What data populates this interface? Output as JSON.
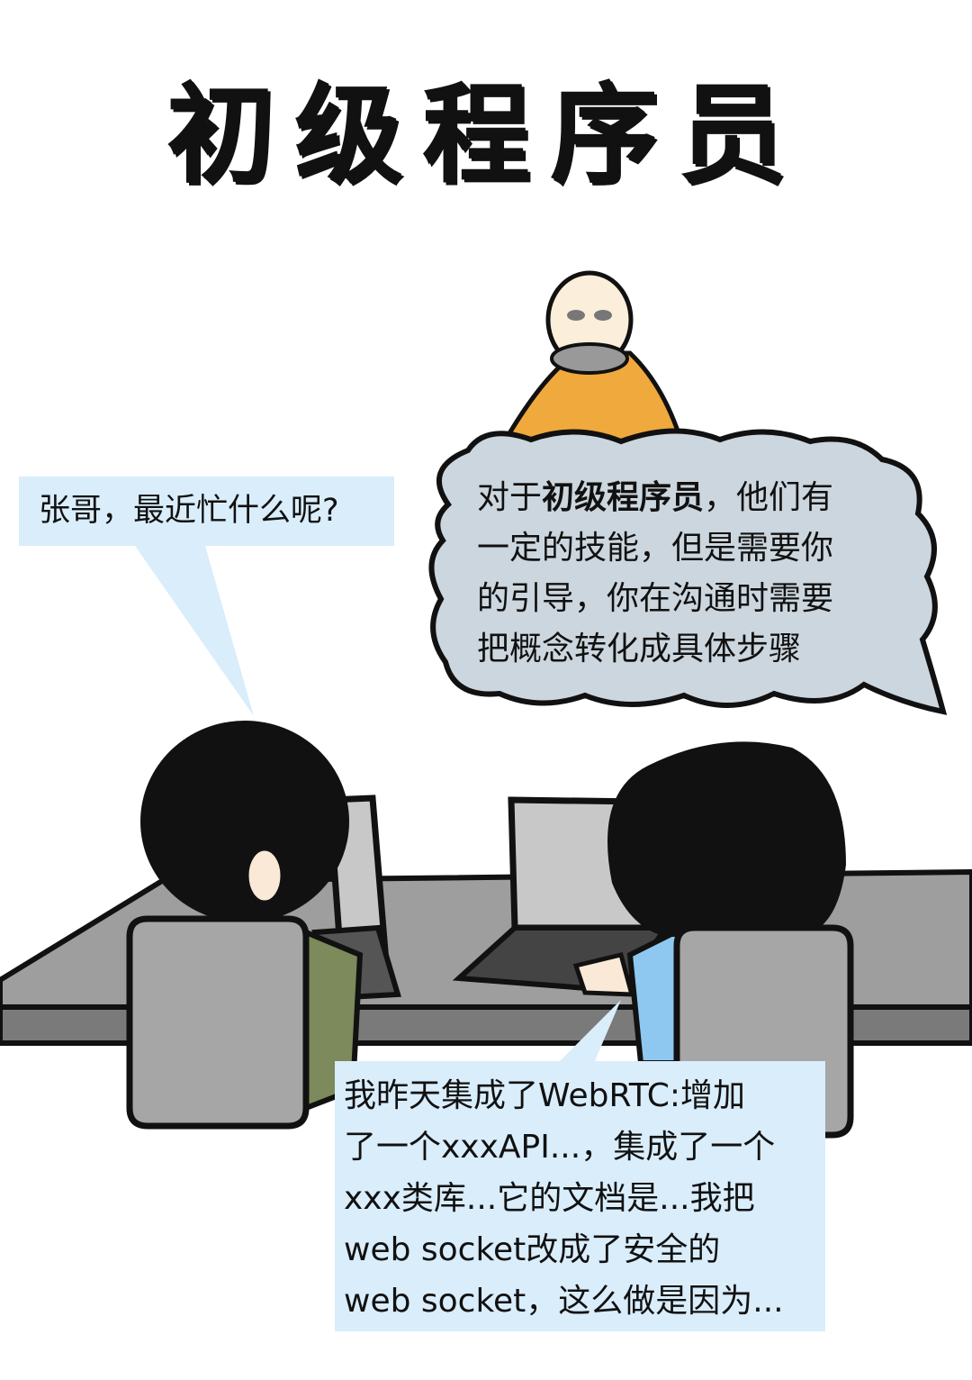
{
  "title": "初级程序员",
  "bubbles": {
    "question": "张哥，最近忙什么呢?",
    "narrator": {
      "prefix": "对于",
      "highlight": "初级程序员",
      "suffix": "，他们有一定的技能，但是需要你的引导，你在沟通时需要把概念转化成具体步骤",
      "lines": [
        "对于初级程序员，他们有",
        "一定的技能，但是需要你",
        "的引导，你在沟通时需要",
        "把概念转化成具体步骤"
      ]
    },
    "answer": {
      "lines": [
        "我昨天集成了WebRTC:增加",
        "了一个xxxAPI...，集成了一个",
        "xxx类库...它的文档是...我把",
        "web  socket改成了安全的",
        "web socket，这么做是因为..."
      ]
    }
  },
  "colors": {
    "bubble_fill": "#d9edfb",
    "cloud_fill": "#ccd6de",
    "robe": "#f0a93c",
    "table": "#9e9e9e",
    "chair": "#a6a6a6",
    "shirt_green": "#7c8a5c",
    "shirt_blue": "#8ec8f0",
    "laptop_screen": "#c8c8c8"
  }
}
